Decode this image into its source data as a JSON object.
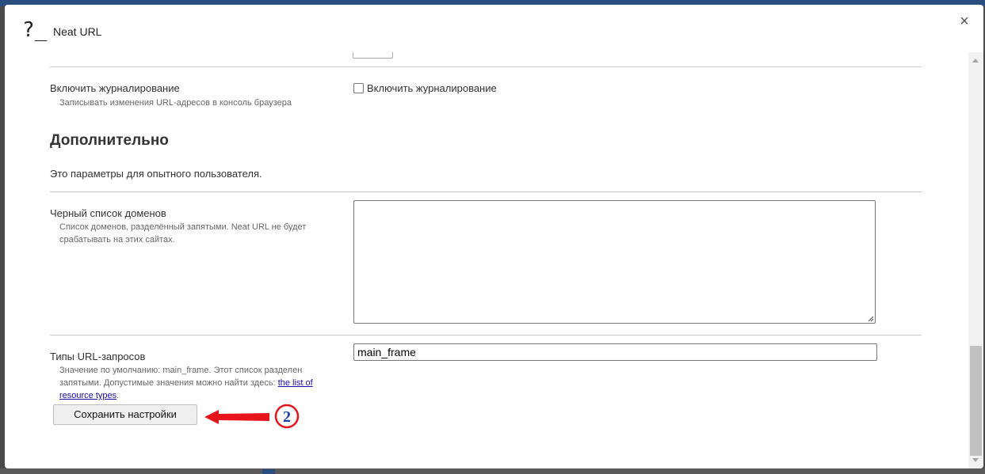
{
  "dialog": {
    "app_icon": "?_",
    "title": "Neat URL",
    "close_label": "×"
  },
  "logging": {
    "label": "Включить журналирование",
    "description": "Записывать изменения URL-адресов в консоль браузера",
    "checkbox_label": "Включить журналирование",
    "checked": false
  },
  "advanced": {
    "title": "Дополнительно",
    "note": "Это параметры для опытного пользователя."
  },
  "blacklist": {
    "label": "Черный список доменов",
    "description_line1": "Список доменов, разделённый запятыми. Neat URL не будет",
    "description_line2": "срабатывать на этих сайтах.",
    "value": ""
  },
  "request_types": {
    "label": "Типы URL-запросов",
    "description_line1": "Значение по умолчанию: main_frame. Этот список разделен",
    "description_line2_prefix": "запятыми. Допустимые значения можно найти здесь: ",
    "link_part1": "the list of",
    "link_part2": "resource types",
    "description_suffix": ".",
    "value": "main_frame"
  },
  "save_button_label": "Сохранить настройки",
  "annotation": {
    "number": "2",
    "color": "#e8141c"
  },
  "icons": {
    "close": "close-icon",
    "resize": "resize-handle-icon",
    "arrow": "red-arrow-icon"
  }
}
